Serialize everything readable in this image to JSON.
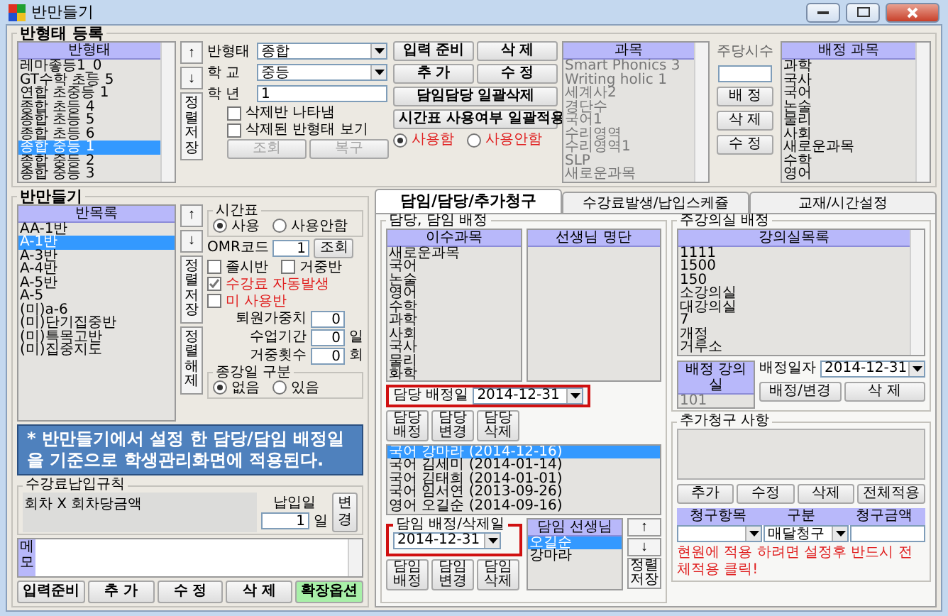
{
  "window": {
    "title": "반만들기"
  },
  "class_type_section": {
    "title": "반형태 등록",
    "list": {
      "header": "반형태",
      "items": [
        {
          "label": "레마좋등1_0",
          "selected": false
        },
        {
          "label": "GT수학 초등 5",
          "selected": false
        },
        {
          "label": "연합 초중등 1",
          "selected": false
        },
        {
          "label": "종합 초등 4",
          "selected": false
        },
        {
          "label": "종합 초등 5",
          "selected": false
        },
        {
          "label": "종합 초등 6",
          "selected": false
        },
        {
          "label": "종합 중등 1",
          "selected": true
        },
        {
          "label": "종합 중등 2",
          "selected": false
        },
        {
          "label": "종합 중등 3",
          "selected": false
        }
      ]
    },
    "sort_buttons": [
      "↑",
      "↓",
      "정렬저장"
    ],
    "fields": [
      {
        "label": "반형태",
        "value": "종합",
        "kind": "dropdown"
      },
      {
        "label": "학 교",
        "value": "중등",
        "kind": "dropdown"
      },
      {
        "label": "학 년",
        "value": "1",
        "kind": "text"
      }
    ],
    "checkboxes": [
      {
        "label": "삭제반 나타냄",
        "checked": false
      },
      {
        "label": "삭제된 반형태 보기",
        "checked": false
      }
    ],
    "buttons": [
      {
        "label": "조회",
        "disabled": true
      },
      {
        "label": "복구",
        "disabled": true
      }
    ],
    "action_buttons": [
      "입력 준비",
      "삭 제",
      "추 가",
      "수 정"
    ],
    "bulk_buttons": [
      "담임담당 일괄삭제",
      "시간표 사용여부 일괄적용"
    ],
    "radios": [
      {
        "label": "사용함",
        "selected": true
      },
      {
        "label": "사용안함",
        "selected": false
      }
    ],
    "subjects": {
      "header": "과목",
      "items": [
        "Smart Phonics 3",
        "Writing holic 1",
        "세계사2",
        "경단수",
        "국어1",
        "수리영역",
        "수리영역1",
        "SLP",
        "새로운과목"
      ]
    },
    "weekly_hours": {
      "label": "주당시수"
    },
    "subject_buttons": [
      "배 정",
      "삭 제",
      "수 정"
    ],
    "assigned_subjects": {
      "header": "배정 과목",
      "items": [
        "과학",
        "국사",
        "국어",
        "논술",
        "물리",
        "사회",
        "새로운과목",
        "수학",
        "영어"
      ]
    }
  },
  "class_section": {
    "title": "반만들기",
    "list": {
      "header": "반목록",
      "items": [
        {
          "label": "AA-1반",
          "selected": false
        },
        {
          "label": "A-1반",
          "selected": true
        },
        {
          "label": "A-3반",
          "selected": false
        },
        {
          "label": "A-4반",
          "selected": false
        },
        {
          "label": "A-5반",
          "selected": false
        },
        {
          "label": "A-5",
          "selected": false
        },
        {
          "label": "(미)a-6",
          "selected": false
        },
        {
          "label": "(미)단기집중반",
          "selected": false
        },
        {
          "label": "(미)특목고반",
          "selected": false
        },
        {
          "label": "(미)집중지도",
          "selected": false
        }
      ]
    },
    "sort_buttons": [
      "↑",
      "↓",
      "정렬저장",
      "정렬해제"
    ],
    "timetable": {
      "title": "시간표",
      "radios": [
        {
          "label": "사용",
          "selected": true
        },
        {
          "label": "사용안함",
          "selected": false
        }
      ]
    },
    "omr": {
      "label": "OMR코드",
      "value": "1",
      "button": "조회"
    },
    "checkboxes": [
      {
        "label": "졸시반",
        "checked": false,
        "alert": false
      },
      {
        "label": "거중반",
        "checked": false,
        "alert": false
      },
      {
        "label": "수강료 자동발생",
        "checked": true,
        "alert": true
      },
      {
        "label": "미 사용반",
        "checked": false,
        "alert": true
      }
    ],
    "number_fields": [
      {
        "label": "퇴원가중치",
        "value": "0"
      },
      {
        "label": "수업기간",
        "value": "0",
        "unit": "일"
      },
      {
        "label": "거중횟수",
        "value": "0",
        "unit": "회"
      }
    ],
    "end_date": {
      "title": "종강일 구분",
      "radios": [
        {
          "label": "없음",
          "selected": true
        },
        {
          "label": "있음",
          "selected": false
        }
      ]
    },
    "callout": "* 반만들기에서 설정 한 담당/담임 배정일을 기준으로 학생관리화면에 적용된다.",
    "fee_rule": {
      "title": "수강료납입규칙",
      "value": "회차 X 회차당금액",
      "due_label": "납입일",
      "due_value": "1",
      "due_unit": "일",
      "change_button": "변경"
    },
    "memo": {
      "label": "메모"
    },
    "buttons": [
      {
        "label": "입력준비",
        "kind": "normal"
      },
      {
        "label": "추 가",
        "kind": "normal"
      },
      {
        "label": "수 정",
        "kind": "normal"
      },
      {
        "label": "삭 제",
        "kind": "normal"
      },
      {
        "label": "확장옵션",
        "kind": "highlight"
      }
    ]
  },
  "tabs": [
    {
      "label": "담임/담당/추가청구",
      "selected": true
    },
    {
      "label": "수강료발생/납입스케쥴",
      "selected": false
    },
    {
      "label": "교재/시간설정",
      "selected": false
    }
  ],
  "assignment": {
    "title": "담당, 담임 배정",
    "subjects": {
      "header": "이수과목",
      "items": [
        "새로운과목",
        "국어",
        "논술",
        "영어",
        "수학",
        "과학",
        "사회",
        "국사",
        "물리",
        "화학"
      ]
    },
    "teachers": {
      "header": "선생님 명단"
    },
    "charge_date": {
      "label": "담당 배정일",
      "value": "2014-12-31"
    },
    "charge_buttons": [
      "담당 배정",
      "담당 변경",
      "담당 삭제"
    ],
    "charge_list": [
      {
        "label": "국어 강마라 (2014-12-16)",
        "selected": true
      },
      {
        "label": "국어 김세미 (2014-01-14)",
        "selected": false
      },
      {
        "label": "국어 김태희 (2014-01-01)",
        "selected": false
      },
      {
        "label": "국어 임서연 (2013-09-26)",
        "selected": false
      },
      {
        "label": "영어 오길순 (2014-09-16)",
        "selected": false
      }
    ],
    "homeroom_date": {
      "title": "담임 배정/삭제일",
      "value": "2014-12-31"
    },
    "homeroom_teachers": {
      "header": "담임 선생님",
      "items": [
        {
          "label": "오길순",
          "selected": true
        },
        {
          "label": "강마라",
          "selected": false
        }
      ]
    },
    "homeroom_sort_buttons": [
      "↑",
      "↓",
      "정렬저장"
    ],
    "homeroom_buttons": [
      "담임 배정",
      "담임 변경",
      "담임 삭제"
    ]
  },
  "classroom": {
    "title": "주강의실 배정",
    "list": {
      "header": "강의실목록",
      "items": [
        "1111",
        "1500",
        "150",
        "소강의실",
        "대강의실",
        "7",
        "개정",
        "거루소"
      ]
    },
    "assigned": {
      "header": "배정 강의실",
      "value": "101"
    },
    "date": {
      "label": "배정일자",
      "value": "2014-12-31"
    },
    "buttons": [
      "배정/변경",
      "삭 제"
    ]
  },
  "extra_charge": {
    "title": "추가청구 사항",
    "buttons": [
      "추가",
      "수정",
      "삭제",
      "전체적용"
    ],
    "columns": [
      "청구항목",
      "구분",
      "청구금액"
    ],
    "row": {
      "type_value": "매달청구"
    },
    "note": "현원에 적용 하려면 설정후 반드시 전체적용 클릭!"
  }
}
